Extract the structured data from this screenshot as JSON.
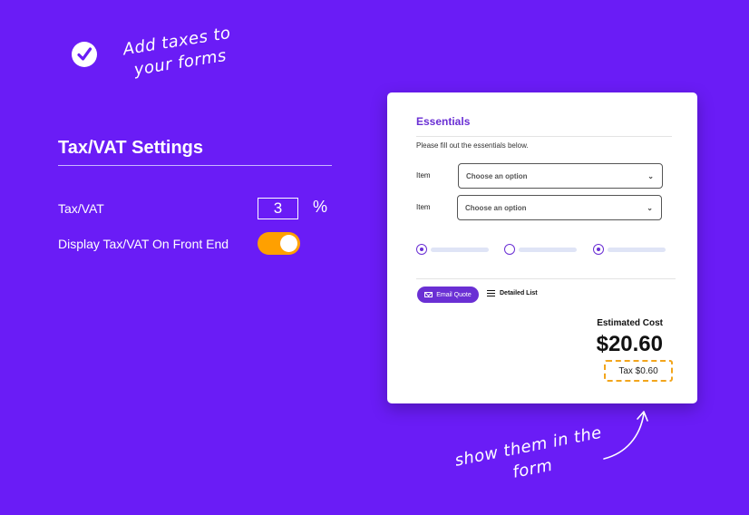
{
  "callouts": {
    "top_note": [
      "Add taxes to",
      "your forms"
    ],
    "bottom_note": [
      "show them in the",
      "form"
    ]
  },
  "settings": {
    "title": "Tax/VAT Settings",
    "tax_label": "Tax/VAT",
    "tax_value": "3",
    "percent_symbol": "%",
    "display_label": "Display Tax/VAT On Front End",
    "display_toggle_on": true
  },
  "form_preview": {
    "section_title": "Essentials",
    "description": "Please fill out the essentials below.",
    "fields": [
      {
        "label": "Item",
        "placeholder": "Choose an option"
      },
      {
        "label": "Item",
        "placeholder": "Choose an option"
      }
    ],
    "radio_options": [
      {
        "selected": true
      },
      {
        "selected": false
      },
      {
        "selected": true
      }
    ],
    "email_quote_label": "Email Quote",
    "detailed_list_label": "Detailed List",
    "estimated_cost_label": "Estimated Cost",
    "total": "$20.60",
    "tax_line": "Tax $0.60"
  },
  "colors": {
    "background": "#6a1cf6",
    "toggle_on": "#ffa000",
    "accent": "#6a2fd4",
    "tax_highlight": "#f2a51c"
  },
  "icons": [
    "check-circle-icon",
    "chevron-down-icon",
    "envelope-icon",
    "list-icon",
    "curved-arrow-icon"
  ]
}
